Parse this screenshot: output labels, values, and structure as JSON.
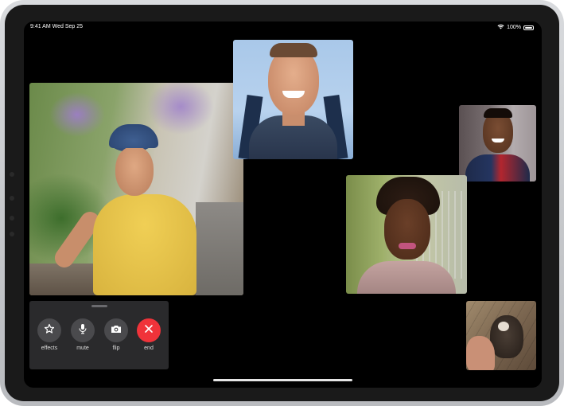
{
  "status_bar": {
    "time_date": "9:41 AM  Wed Sep 25",
    "battery_percent": "100%",
    "icons": [
      "wifi-icon",
      "battery-icon"
    ]
  },
  "participants": [
    {
      "name": "participant-large",
      "description_icon": "video-tile"
    },
    {
      "name": "participant-top-center",
      "description_icon": "video-tile"
    },
    {
      "name": "participant-top-right",
      "description_icon": "video-tile"
    },
    {
      "name": "participant-middle-right",
      "description_icon": "video-tile"
    },
    {
      "name": "participant-bottom-right",
      "description_icon": "video-tile"
    }
  ],
  "controls": {
    "effects_label": "effects",
    "mute_label": "mute",
    "flip_label": "flip",
    "end_label": "end",
    "end_color": "#f0333a",
    "button_color": "#4a4a4d"
  }
}
